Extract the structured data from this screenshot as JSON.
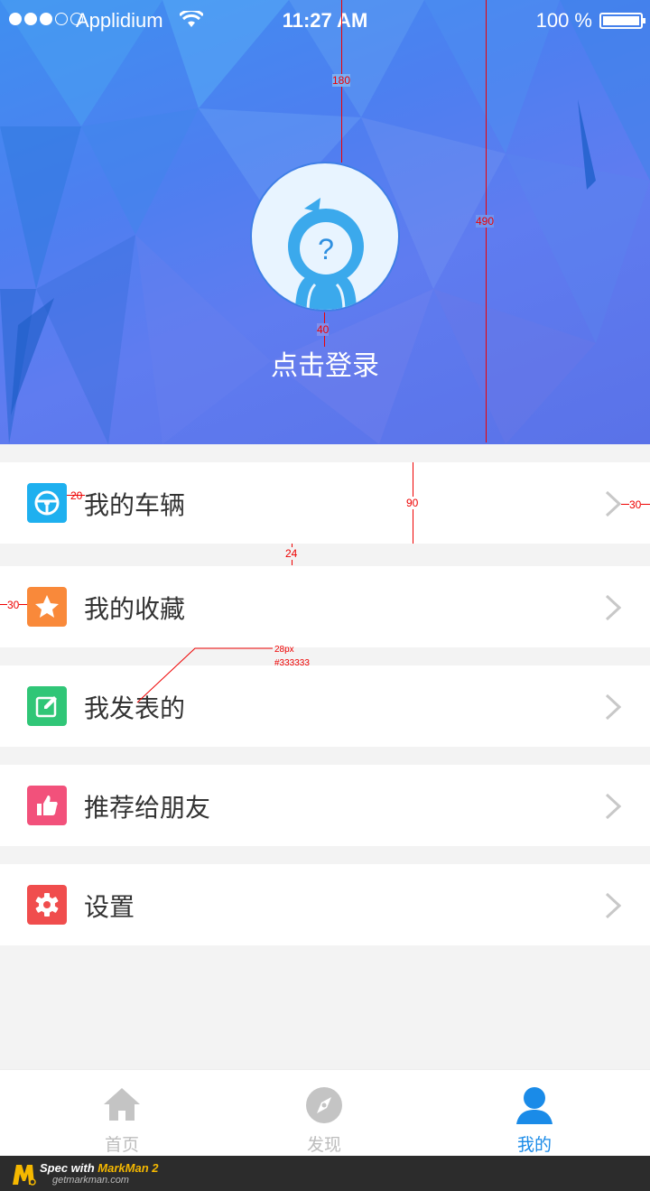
{
  "status_bar": {
    "carrier": "Applidium",
    "time": "11:27 AM",
    "battery": "100 %"
  },
  "profile": {
    "avatar_mark": "?",
    "login_label": "点击登录"
  },
  "menu": [
    {
      "label": "我的车辆",
      "icon": "steering-wheel-icon",
      "color": "#1eb0ef"
    },
    {
      "label": "我的收藏",
      "icon": "star-icon",
      "color": "#f9893a"
    },
    {
      "label": "我发表的",
      "icon": "edit-icon",
      "color": "#30c677"
    },
    {
      "label": "推荐给朋友",
      "icon": "thumbs-up-icon",
      "color": "#f2517b"
    },
    {
      "label": "设置",
      "icon": "gear-icon",
      "color": "#f04d4d"
    }
  ],
  "tabs": [
    {
      "label": "首页",
      "icon": "home-icon"
    },
    {
      "label": "发现",
      "icon": "compass-icon"
    },
    {
      "label": "我的",
      "icon": "user-icon",
      "active": true
    }
  ],
  "annotations": {
    "avatar_top": "180",
    "header_height": "490",
    "avatar_gap": "40",
    "item_height": "90",
    "icon_gap": "20",
    "right_pad": "30",
    "left_pad": "30",
    "group_gap": "24",
    "font_size_note": "28px",
    "font_color_note": "#333333"
  },
  "footer_brand": {
    "spec_with": "Spec with ",
    "product": "MarkMan 2",
    "site": "getmarkman.com"
  },
  "colors": {
    "accent": "#1a8be8",
    "text_primary": "#333333",
    "tab_inactive": "#bdbdbd"
  }
}
